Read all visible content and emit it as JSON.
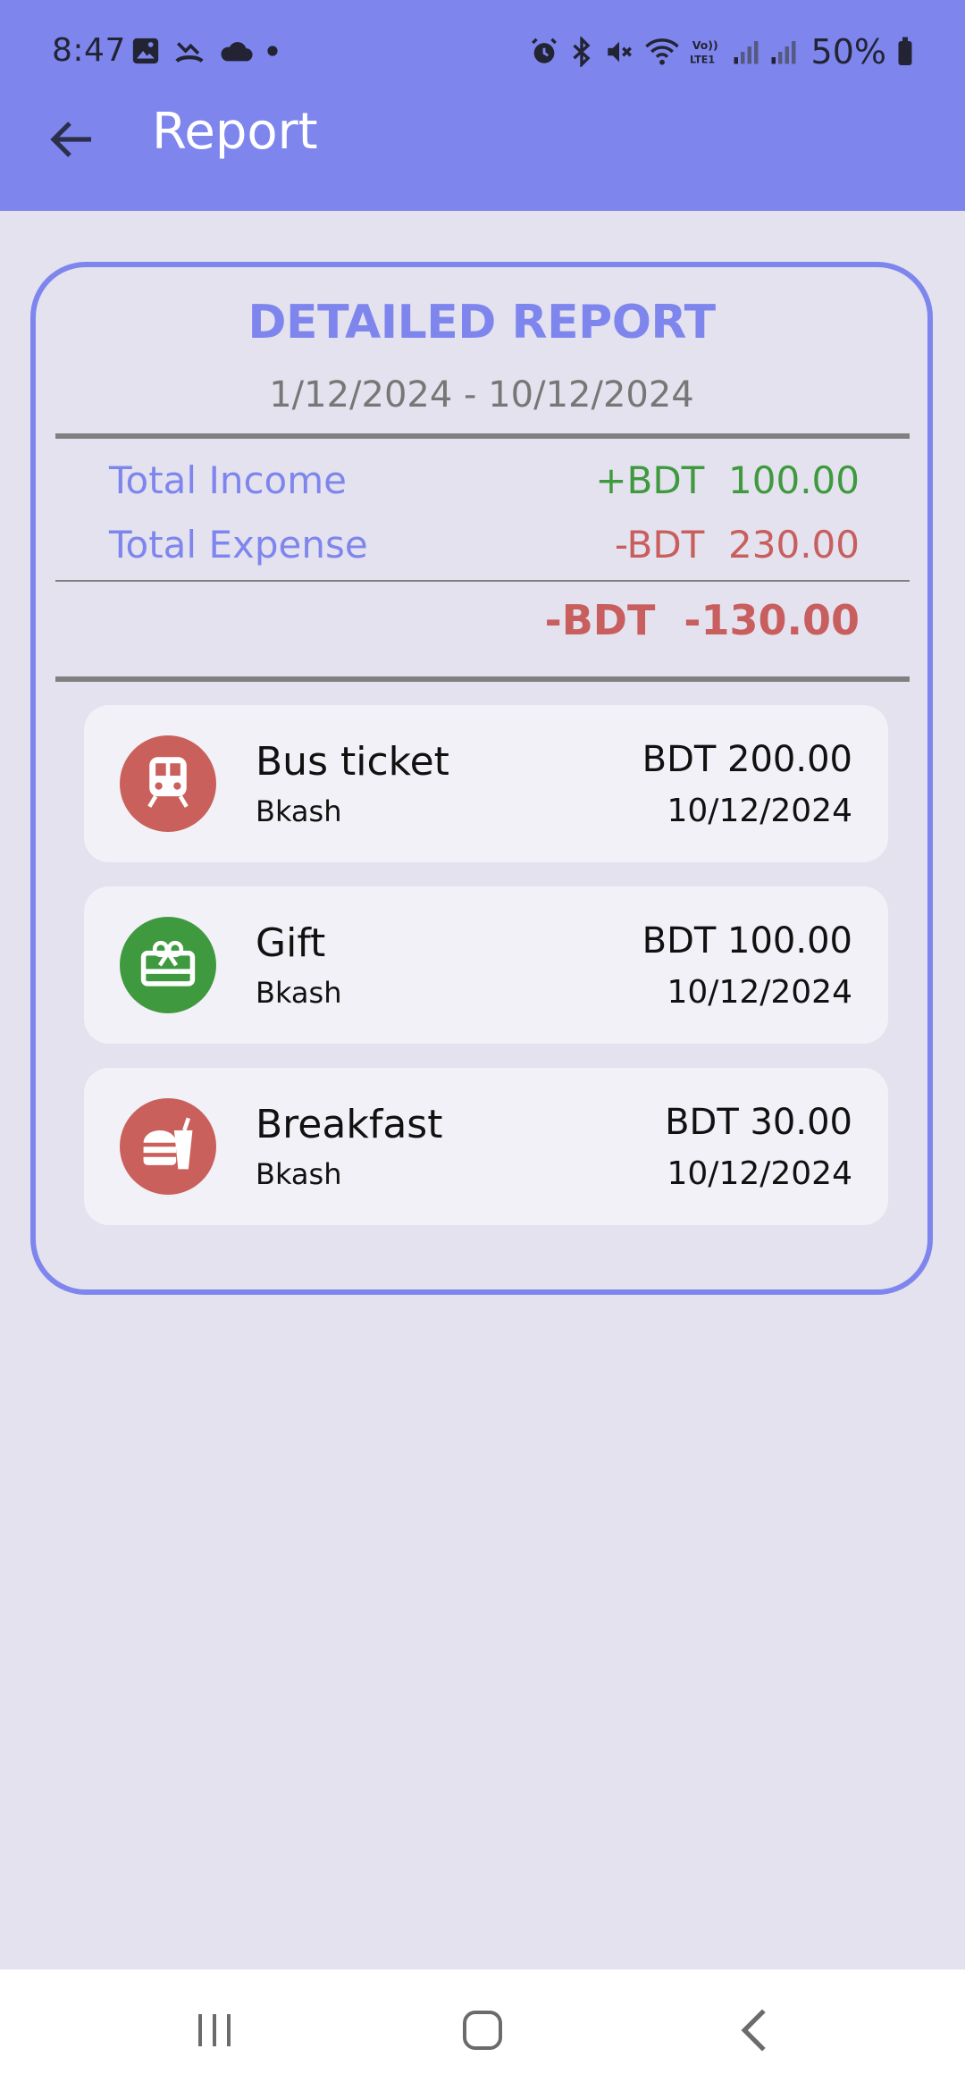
{
  "status_bar": {
    "time": "8:47",
    "battery": "50%",
    "left_icons": [
      "gallery-icon",
      "missed-call-icon",
      "cloud-icon",
      "dot-icon"
    ],
    "right_icons": [
      "alarm-icon",
      "bluetooth-icon",
      "mute-icon",
      "wifi-icon",
      "volte-icon",
      "signal-icon",
      "signal-icon",
      "battery-icon"
    ]
  },
  "app_bar": {
    "title": "Report",
    "back_icon": "arrow-left-icon"
  },
  "report": {
    "title": "DETAILED REPORT",
    "date_range": "1/12/2024 - 10/12/2024",
    "total_income_label": "Total Income",
    "total_income_value": "+BDT  100.00",
    "total_expense_label": "Total Expense",
    "total_expense_value": "-BDT  230.00",
    "net_value": "-BDT  -130.00"
  },
  "transactions": [
    {
      "name": "Bus ticket",
      "method": "Bkash",
      "amount": "BDT 200.00",
      "date": "10/12/2024",
      "icon": "train-icon",
      "color": "#c9605c"
    },
    {
      "name": "Gift",
      "method": "Bkash",
      "amount": "BDT 100.00",
      "date": "10/12/2024",
      "icon": "gift-card-icon",
      "color": "#3f9a3f"
    },
    {
      "name": "Breakfast",
      "method": "Bkash",
      "amount": "BDT 30.00",
      "date": "10/12/2024",
      "icon": "fastfood-icon",
      "color": "#c9605c"
    }
  ],
  "colors": {
    "accent": "#7e86ee",
    "income": "#3f9a3f",
    "expense": "#c85e5e",
    "background": "#e4e2ee"
  },
  "nav_bar": {
    "recents_icon": "recents-icon",
    "home_icon": "home-icon",
    "back_icon": "back-chevron-icon"
  }
}
